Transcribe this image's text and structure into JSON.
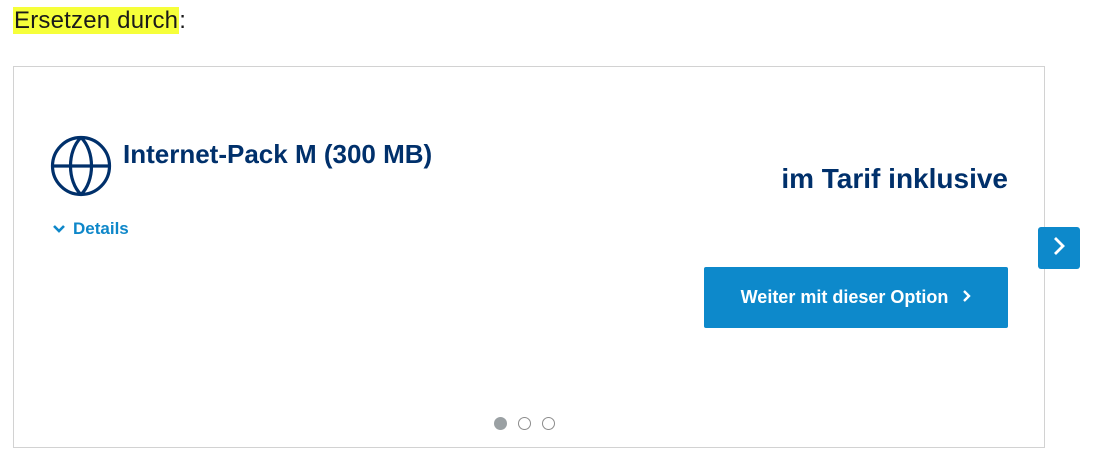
{
  "heading": {
    "highlighted": "Ersetzen durch",
    "suffix": ":"
  },
  "card": {
    "icon": "globe-icon",
    "title": "Internet-Pack M (300 MB)",
    "details_label": "Details",
    "price_text": "im Tarif inklusive",
    "cta_label": "Weiter mit dieser Option",
    "pagination": {
      "total": 3,
      "active_index": 0
    }
  },
  "colors": {
    "brand_dark": "#00306b",
    "accent": "#0d89cb",
    "highlight": "#f6ff3a"
  }
}
